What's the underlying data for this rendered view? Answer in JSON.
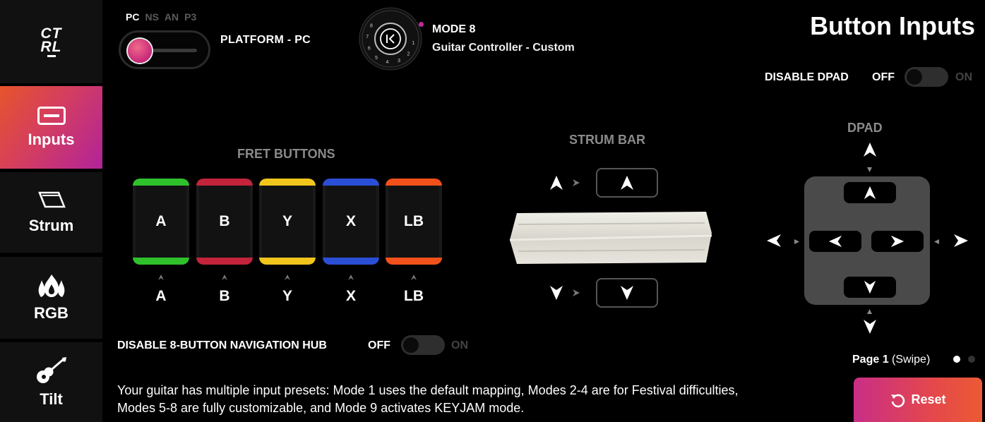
{
  "app": {
    "logo_line1": "CT",
    "logo_line2": "RL"
  },
  "sidebar": {
    "items": [
      {
        "label": "Inputs",
        "active": true,
        "icon": "controller-icon"
      },
      {
        "label": "Strum",
        "active": false,
        "icon": "strum-bar-icon"
      },
      {
        "label": "RGB",
        "active": false,
        "icon": "flames-icon"
      },
      {
        "label": "Tilt",
        "active": false,
        "icon": "guitar-icon"
      }
    ]
  },
  "platform": {
    "options": [
      "PC",
      "NS",
      "AN",
      "P3"
    ],
    "selected": "PC",
    "label": "PLATFORM - PC"
  },
  "mode": {
    "dial_numbers": [
      "1",
      "2",
      "3",
      "4",
      "5",
      "6",
      "7",
      "8"
    ],
    "title": "MODE 8",
    "subtitle": "Guitar Controller - Custom"
  },
  "page_title": "Button Inputs",
  "disable_dpad": {
    "label": "DISABLE DPAD",
    "off": "OFF",
    "on": "ON"
  },
  "fret_buttons": {
    "title": "FRET BUTTONS",
    "buttons": [
      {
        "label": "A",
        "mapped": "A",
        "color": "#2fc12c"
      },
      {
        "label": "B",
        "mapped": "B",
        "color": "#c3233b"
      },
      {
        "label": "Y",
        "mapped": "Y",
        "color": "#f1c51b"
      },
      {
        "label": "X",
        "mapped": "X",
        "color": "#2a4fd6"
      },
      {
        "label": "LB",
        "mapped": "LB",
        "color": "#f2511b"
      }
    ]
  },
  "strum_bar": {
    "title": "STRUM BAR"
  },
  "dpad": {
    "title": "DPAD"
  },
  "nav_hub": {
    "label": "DISABLE 8-BUTTON NAVIGATION HUB",
    "off": "OFF",
    "on": "ON"
  },
  "description": "Your guitar has multiple input presets: Mode 1 uses the default mapping, Modes 2-4 are for Festival difficulties, Modes 5-8 are fully customizable, and Mode 9 activates KEYJAM mode.",
  "pager": {
    "page": "Page 1",
    "hint": "(Swipe)",
    "pages": 2,
    "current": 1
  },
  "reset": {
    "label": "Reset"
  }
}
